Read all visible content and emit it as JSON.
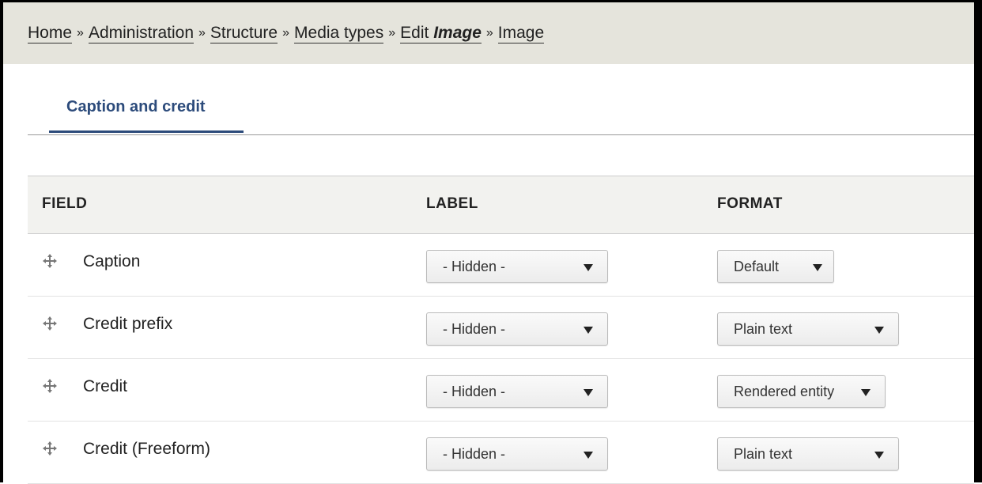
{
  "breadcrumb": {
    "home": "Home",
    "administration": "Administration",
    "structure": "Structure",
    "media_types": "Media types",
    "edit_prefix": "Edit",
    "edit_em": "Image",
    "current": "Image",
    "separator": "»"
  },
  "tabs": [
    {
      "label": "Caption and credit",
      "active": true
    }
  ],
  "table": {
    "headers": {
      "field": "FIELD",
      "label": "LABEL",
      "format": "FORMAT"
    },
    "rows": [
      {
        "field": "Caption",
        "label": "- Hidden -",
        "format": "Default"
      },
      {
        "field": "Credit prefix",
        "label": "- Hidden -",
        "format": "Plain text"
      },
      {
        "field": "Credit",
        "label": "- Hidden -",
        "format": "Rendered entity"
      },
      {
        "field": "Credit (Freeform)",
        "label": "- Hidden -",
        "format": "Plain text"
      }
    ]
  },
  "colors": {
    "tab_accent": "#2c4b7b",
    "breadcrumb_bg": "#e5e4dc",
    "header_bg": "#f2f2ef"
  }
}
